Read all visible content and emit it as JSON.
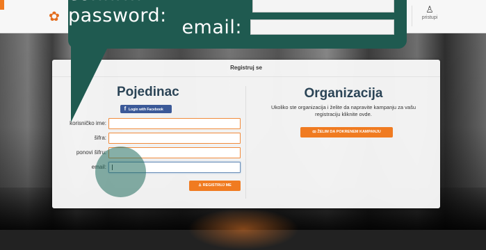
{
  "header": {
    "login_label": "pristupi"
  },
  "tooltip": {
    "line1": "confirm password:",
    "line2": "email:"
  },
  "panel": {
    "title": "Registruj se",
    "individual": {
      "heading": "Pojedinac",
      "facebook_label": "Login with Facebook",
      "fields": [
        {
          "label": "korisničko ime:",
          "value": ""
        },
        {
          "label": "šifra:",
          "value": ""
        },
        {
          "label": "ponovi šifru:",
          "value": ""
        },
        {
          "label": "email:",
          "value": ""
        }
      ],
      "register_label": "REGISTRUJ ME"
    },
    "organization": {
      "heading": "Organizacija",
      "text": "Ukoliko ste organizacija i želite da napravite kampanju za vašu registraciju kliknite ovde.",
      "campaign_label": "ŽELIM DA POKRENEM KAMPANJU"
    }
  },
  "colors": {
    "accent": "#f07b21",
    "tooltip": "#1f5a50",
    "facebook": "#3b5998",
    "heading": "#2b4456"
  }
}
